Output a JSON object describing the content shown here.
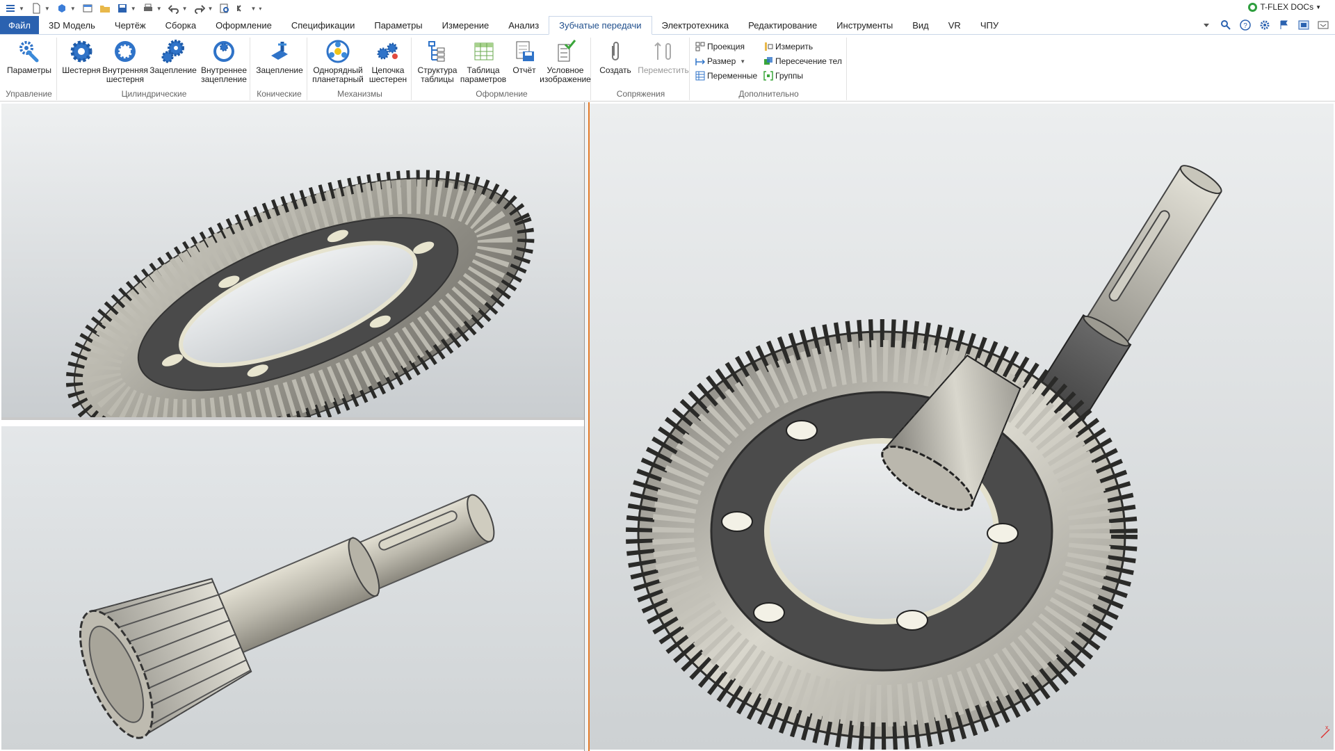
{
  "app": {
    "brand": "T-FLEX DOCs",
    "accent": "#2b62b0",
    "active_tab_text": "#1f4e8c",
    "splitter_color": "#e37b2a"
  },
  "qat": {
    "icons": [
      "menu-icon",
      "new-icon",
      "open-3d-icon",
      "window-icon",
      "folder-icon",
      "save-icon",
      "print-icon",
      "undo-icon",
      "redo-icon",
      "find-icon",
      "history-icon",
      "customize-icon"
    ]
  },
  "tabs": [
    {
      "label": "Файл"
    },
    {
      "label": "3D Модель"
    },
    {
      "label": "Чертёж"
    },
    {
      "label": "Сборка"
    },
    {
      "label": "Оформление"
    },
    {
      "label": "Спецификации"
    },
    {
      "label": "Параметры"
    },
    {
      "label": "Измерение"
    },
    {
      "label": "Анализ"
    },
    {
      "label": "Зубчатые передачи"
    },
    {
      "label": "Электротехника"
    },
    {
      "label": "Редактирование"
    },
    {
      "label": "Инструменты"
    },
    {
      "label": "Вид"
    },
    {
      "label": "VR"
    },
    {
      "label": "ЧПУ"
    }
  ],
  "ribbon": {
    "groups": {
      "control": "Управление",
      "cylindrical": "Цилиндрические",
      "conical": "Конические",
      "mechanisms": "Механизмы",
      "design": "Оформление",
      "mates": "Сопряжения",
      "extra": "Дополнительно"
    },
    "buttons": {
      "params": "Параметры",
      "gear": "Шестерня",
      "internal_gear_1": "Внутренняя",
      "internal_gear_2": "шестерня",
      "mesh": "Зацепление",
      "internal_mesh_1": "Внутреннее",
      "internal_mesh_2": "зацепление",
      "conical_mesh": "Зацепление",
      "planetary_1": "Однорядный",
      "planetary_2": "планетарный",
      "chain_1": "Цепочка",
      "chain_2": "шестерен",
      "table_struct_1": "Структура",
      "table_struct_2": "таблицы",
      "param_table_1": "Таблица",
      "param_table_2": "параметров",
      "report": "Отчёт",
      "symbolic_1": "Условное",
      "symbolic_2": "изображение",
      "create": "Создать",
      "move": "Переместить"
    },
    "small": {
      "projection": "Проекция",
      "size": "Размер",
      "variables": "Переменные",
      "measure": "Измерить",
      "intersection": "Пересечение тел",
      "groups": "Группы"
    }
  }
}
